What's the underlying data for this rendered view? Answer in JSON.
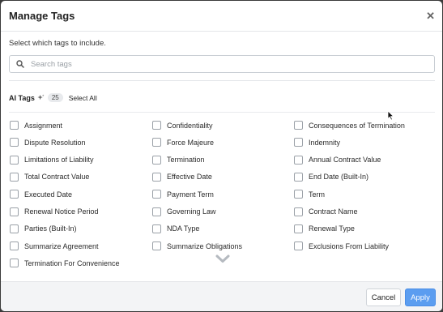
{
  "dialog": {
    "title": "Manage Tags",
    "close_icon": "close-x-icon",
    "subtitle": "Select which tags to include."
  },
  "search": {
    "placeholder": "Search tags",
    "value": "",
    "icon": "search-icon"
  },
  "section": {
    "label": "AI Tags",
    "icon": "sparkle-icon",
    "count": "25",
    "select_all_label": "Select All"
  },
  "tags": [
    {
      "label": "Assignment",
      "checked": false
    },
    {
      "label": "Confidentiality",
      "checked": false
    },
    {
      "label": "Consequences of Termination",
      "checked": false
    },
    {
      "label": "Dispute Resolution",
      "checked": false
    },
    {
      "label": "Force Majeure",
      "checked": false
    },
    {
      "label": "Indemnity",
      "checked": false
    },
    {
      "label": "Limitations of Liability",
      "checked": false
    },
    {
      "label": "Termination",
      "checked": false
    },
    {
      "label": "Annual Contract Value",
      "checked": false
    },
    {
      "label": "Total Contract Value",
      "checked": false
    },
    {
      "label": "Effective Date",
      "checked": false
    },
    {
      "label": "End Date (Built-In)",
      "checked": false
    },
    {
      "label": "Executed Date",
      "checked": false
    },
    {
      "label": "Payment Term",
      "checked": false
    },
    {
      "label": "Term",
      "checked": false
    },
    {
      "label": "Renewal Notice Period",
      "checked": false
    },
    {
      "label": "Governing Law",
      "checked": false
    },
    {
      "label": "Contract Name",
      "checked": false
    },
    {
      "label": "Parties (Built-In)",
      "checked": false
    },
    {
      "label": "NDA Type",
      "checked": false
    },
    {
      "label": "Renewal Type",
      "checked": false
    },
    {
      "label": "Summarize Agreement",
      "checked": false
    },
    {
      "label": "Summarize Obligations",
      "checked": false
    },
    {
      "label": "Exclusions From Liability",
      "checked": false
    },
    {
      "label": "Termination For Convenience",
      "checked": false
    }
  ],
  "scroll_more_icon": "chevron-down-icon",
  "footer": {
    "cancel_label": "Cancel",
    "apply_label": "Apply"
  },
  "colors": {
    "primary": "#5b9df0",
    "footer_bg": "#f3f4f6",
    "backdrop": "#3a3a3a"
  }
}
